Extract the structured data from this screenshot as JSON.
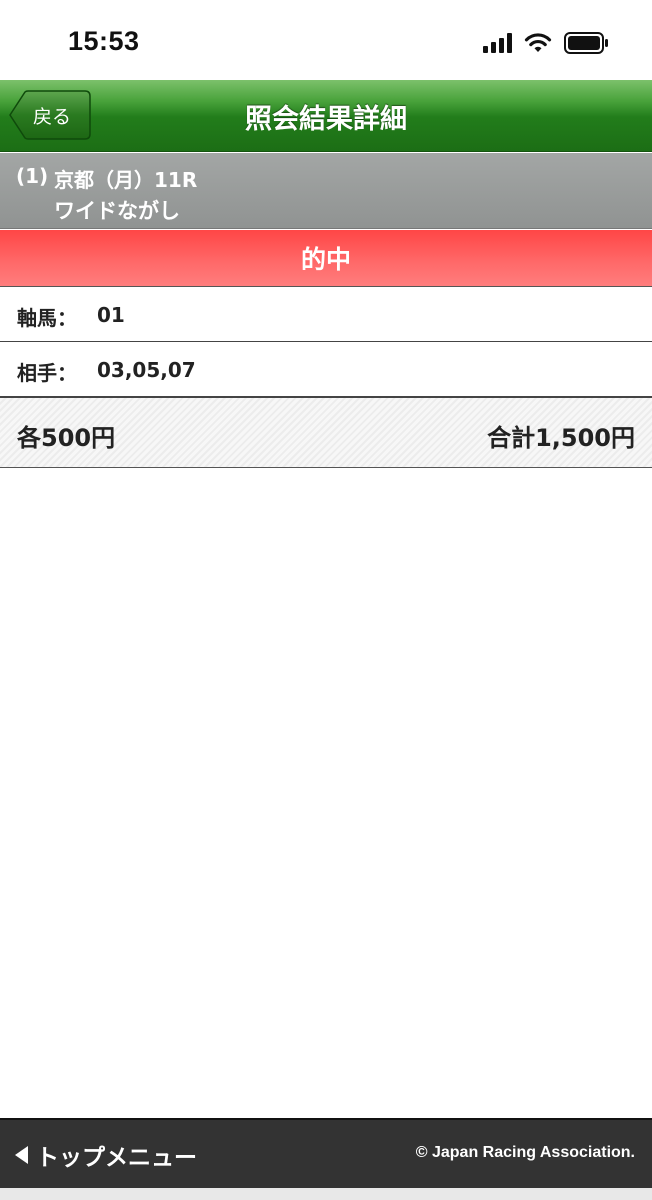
{
  "status_bar": {
    "time": "15:53"
  },
  "nav": {
    "back_label": "戻る",
    "title": "照会結果詳細"
  },
  "race": {
    "number": "(1)",
    "name": "京都（月）11R",
    "bet_type": "ワイドながし"
  },
  "result": {
    "text": "的中"
  },
  "rows": {
    "axis_label": "軸馬：",
    "axis_value": "01",
    "partner_label": "相手：",
    "partner_value": "03,05,07"
  },
  "amounts": {
    "unit": "各500円",
    "total": "合計1,500円"
  },
  "footer": {
    "top_menu_label": "トップメニュー",
    "copyright": "© Japan Racing Association."
  },
  "colors": {
    "nav_green": "#227d1b",
    "hit_red": "#ff4646",
    "header_gray": "#909392",
    "footer_dark": "#333333"
  }
}
